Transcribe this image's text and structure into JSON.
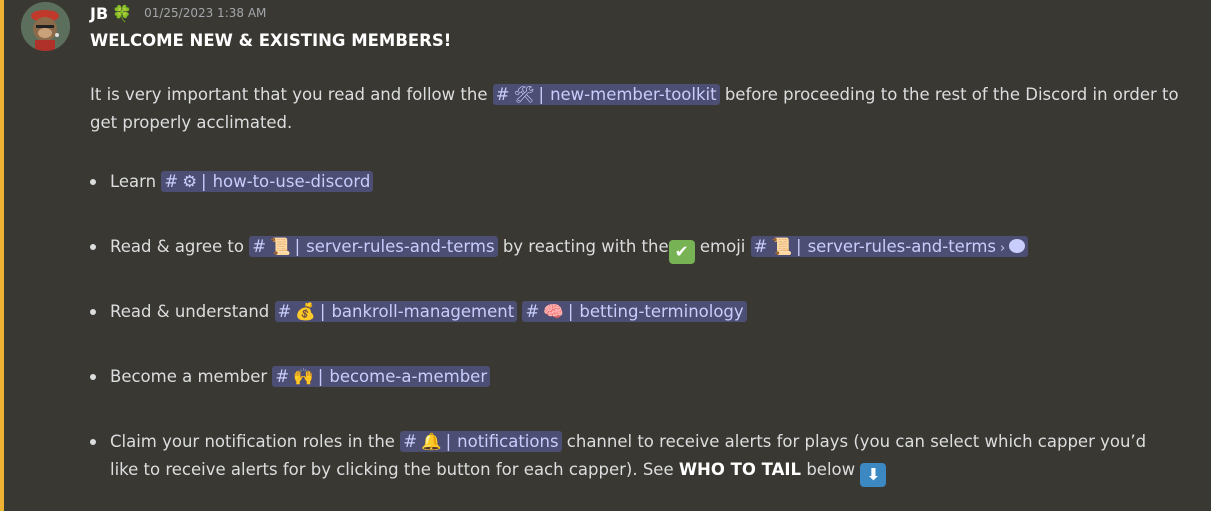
{
  "message": {
    "author": "JB",
    "author_badge": "🍀",
    "timestamp": "01/25/2023 1:38 AM",
    "title": "WELCOME NEW & EXISTING MEMBERS!",
    "intro": {
      "before": "It is very important that you read and follow the",
      "channel": {
        "hash": "#",
        "emoji": "🛠",
        "sep": "|",
        "name": "new-member-toolkit"
      },
      "after": "before proceeding to the rest of the Discord in order to get properly acclimated."
    },
    "bullets": [
      {
        "prefix": "Learn",
        "channel": {
          "hash": "#",
          "emoji": "⚙",
          "sep": "|",
          "name": "how-to-use-discord"
        }
      },
      {
        "prefix": "Read & agree to",
        "channel": {
          "hash": "#",
          "emoji": "📜",
          "sep": "|",
          "name": "server-rules-and-terms"
        },
        "middle": "by reacting with the",
        "check_emoji": "✔",
        "after_check": "emoji",
        "channel2": {
          "hash": "#",
          "emoji": "📜",
          "sep": "|",
          "name": "server-rules-and-terms",
          "chevron": "›"
        }
      },
      {
        "prefix": "Read & understand",
        "channel": {
          "hash": "#",
          "emoji": "💰",
          "sep": "|",
          "name": "bankroll-management"
        },
        "channel2": {
          "hash": "#",
          "emoji": "🧠",
          "sep": "|",
          "name": "betting-terminology"
        }
      },
      {
        "prefix": "Become a member",
        "channel": {
          "hash": "#",
          "emoji": "🙌",
          "sep": "|",
          "name": "become-a-member"
        }
      },
      {
        "prefix": "Claim your notification roles in the",
        "channel": {
          "hash": "#",
          "emoji": "🔔",
          "sep": "|",
          "name": "notifications"
        },
        "middle": "channel to receive alerts for plays (you can select which capper you’d like to receive alerts for by clicking the button for each capper). See",
        "bold": "WHO TO TAIL",
        "after_bold": "below",
        "arrow_emoji": "⬇"
      }
    ]
  },
  "colors": {
    "background": "#3a3833",
    "accent_bar": "#f0b232",
    "mention_bg": "#4d4e74",
    "mention_text": "#c9cdfb"
  }
}
